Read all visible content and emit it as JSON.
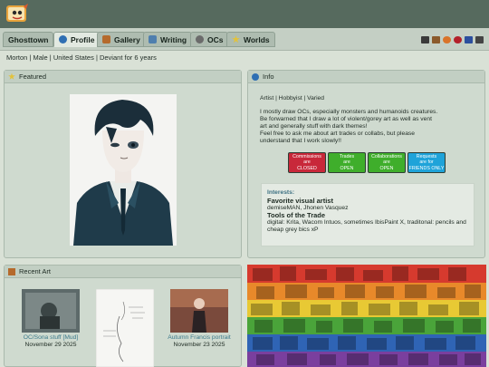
{
  "site": {
    "logo": "ghost-logo"
  },
  "tabs": [
    {
      "label": "Ghosttown",
      "icon": "",
      "active": false
    },
    {
      "label": "Profile",
      "icon": "info-icon",
      "active": true
    },
    {
      "label": "Gallery",
      "icon": "gallery-icon",
      "active": false
    },
    {
      "label": "Writing",
      "icon": "writing-icon",
      "active": false
    },
    {
      "label": "OCs",
      "icon": "paw-icon",
      "active": false
    },
    {
      "label": "Worlds",
      "icon": "star-icon",
      "active": false
    }
  ],
  "profile_line": "Morton | Male | United States | Deviant for 6 years",
  "featured": {
    "title": "Featured"
  },
  "info": {
    "title": "Info",
    "role": "Artist | Hobbyist | Varied",
    "bio": [
      "I mostly draw OCs, especially monsters and humanoids creatures.",
      "Be forwarned that I draw a lot of violent/gorey art as well as vent",
      "art and generally stuff with dark themes!",
      "Feel free to ask me about art trades or collabs, but please",
      "understand that I work slowly!!"
    ],
    "badges": [
      {
        "title": "Commissions",
        "mid": "are",
        "status": "CLOSED",
        "color": "#c8283a"
      },
      {
        "title": "Trades",
        "mid": "are",
        "status": "OPEN",
        "color": "#3fae2b"
      },
      {
        "title": "Collaborations",
        "mid": "are",
        "status": "OPEN",
        "color": "#3fae2b"
      },
      {
        "title": "Requests",
        "mid": "are for",
        "status": "FRIENDS ONLY",
        "color": "#1fa3d9"
      }
    ],
    "interests_title": "Interests:",
    "favorite_label": "Favorite visual artist",
    "favorite_value": "demiseMAN, Jhonen Vasquez",
    "tools_label": "Tools of the Trade",
    "tools_value": "digital: Krita, Wacom Intuos, sometimes IbisPaint X, traditonal: pencils and cheap grey bics xP"
  },
  "recent": {
    "title": "Recent Art",
    "items": [
      {
        "title": "OC/Sona stuff [Mud]",
        "date": "November 29 2025"
      },
      {
        "title": "",
        "date": ""
      },
      {
        "title": "Autumn Francis portrait",
        "date": "November 23 2025"
      }
    ]
  },
  "colors": {
    "topbar": "#566a5e",
    "link": "#3b7a8b"
  }
}
